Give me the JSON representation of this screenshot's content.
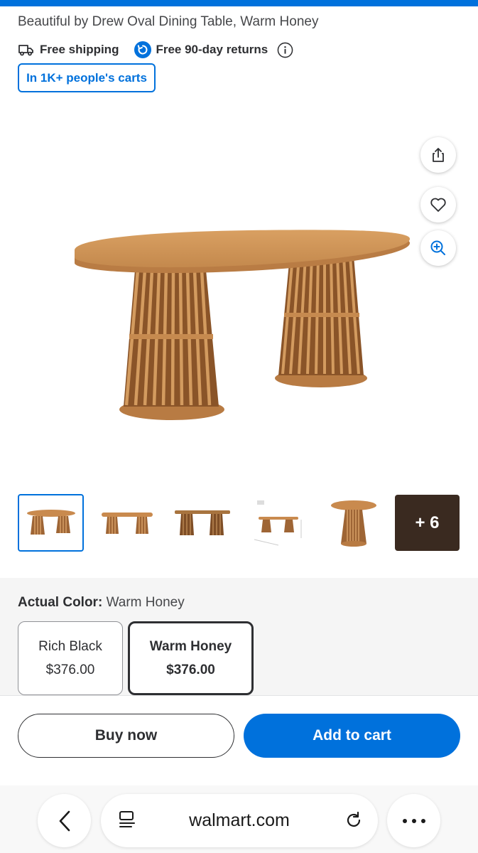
{
  "product": {
    "title": "Beautiful by Drew Oval Dining Table, Warm Honey",
    "shipping_label": "Free shipping",
    "returns_label": "Free 90-day returns",
    "carts_badge": "In 1K+ people's carts"
  },
  "gallery": {
    "more_count": "+ 6"
  },
  "variants": {
    "actual_color_label": "Actual Color:",
    "actual_color_value": "Warm Honey",
    "options": [
      {
        "name": "Rich Black",
        "price": "$376.00",
        "selected": false
      },
      {
        "name": "Warm Honey",
        "price": "$376.00",
        "selected": true
      }
    ]
  },
  "actions": {
    "buy_now": "Buy now",
    "add_to_cart": "Add to cart"
  },
  "browser": {
    "url": "walmart.com"
  },
  "colors": {
    "brand_blue": "#0071dc",
    "wood": "#c98a4e"
  }
}
